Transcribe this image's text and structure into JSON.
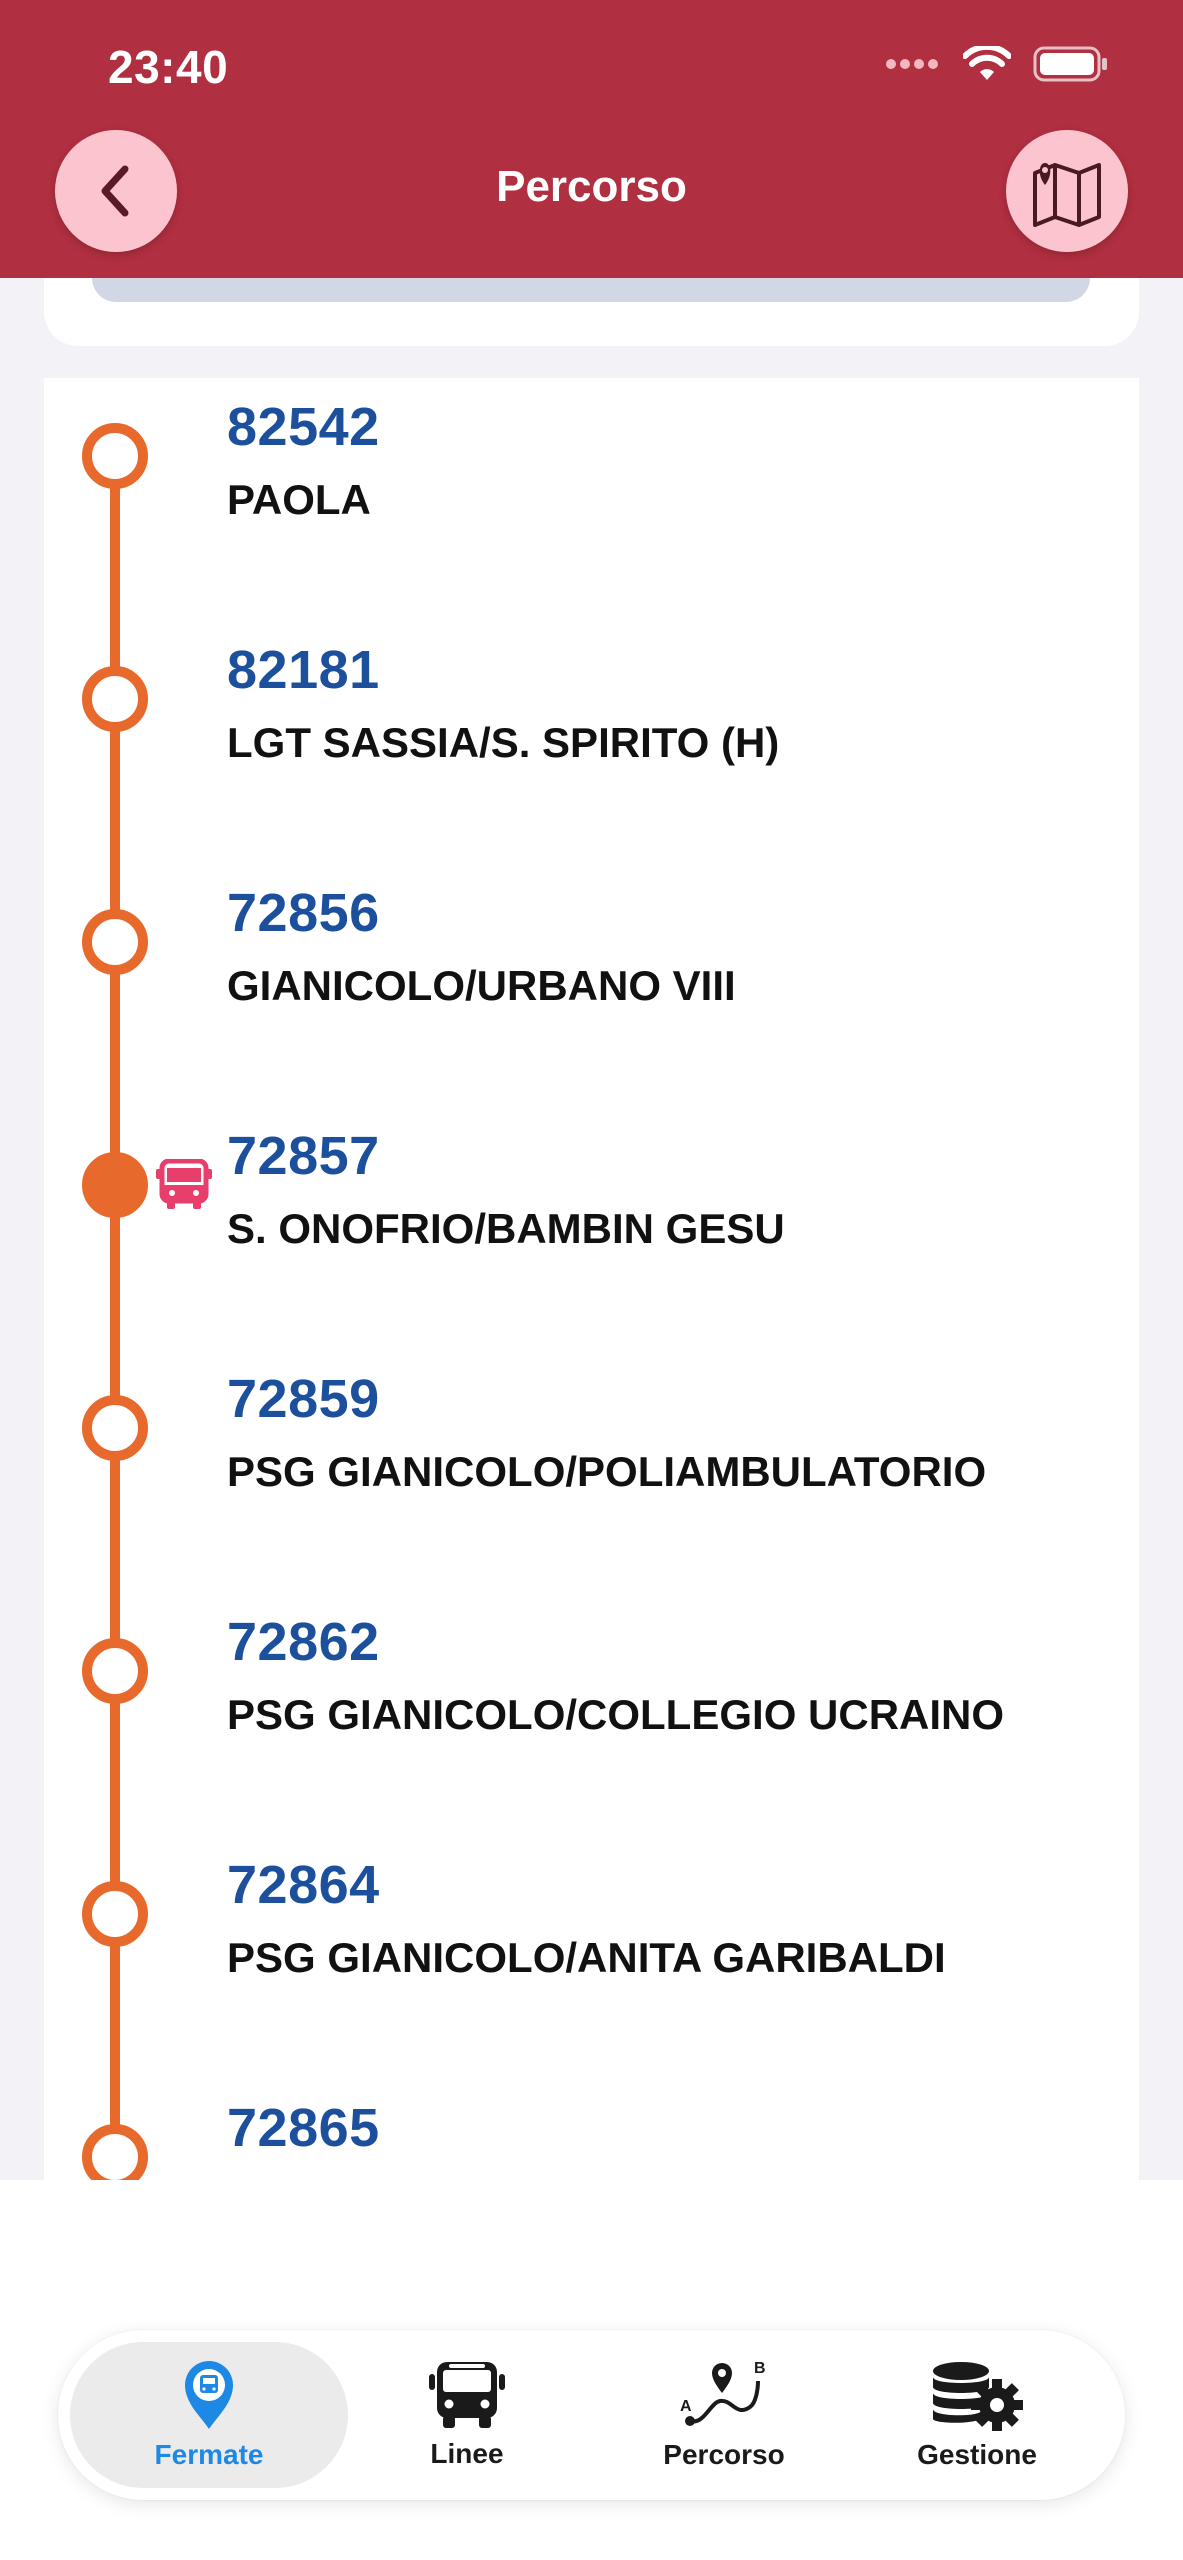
{
  "status_bar": {
    "time": "23:40"
  },
  "header": {
    "title": "Percorso"
  },
  "colors": {
    "header_bg": "#b02f40",
    "button_bg": "#fbc4cf",
    "route_line": "#e8692c",
    "stop_code": "#1c4f9c",
    "bus_icon": "#e83e6c",
    "active_tab": "#1e88e5"
  },
  "stops": [
    {
      "code": "82542",
      "name": "PAOLA",
      "current": false
    },
    {
      "code": "82181",
      "name": "LGT SASSIA/S. SPIRITO (H)",
      "current": false
    },
    {
      "code": "72856",
      "name": "GIANICOLO/URBANO VIII",
      "current": false
    },
    {
      "code": "72857",
      "name": "S. ONOFRIO/BAMBIN GESU",
      "current": true
    },
    {
      "code": "72859",
      "name": "PSG GIANICOLO/POLIAMBULATORIO",
      "current": false
    },
    {
      "code": "72862",
      "name": "PSG GIANICOLO/COLLEGIO UCRAINO",
      "current": false
    },
    {
      "code": "72864",
      "name": "PSG GIANICOLO/ANITA GARIBALDI",
      "current": false
    },
    {
      "code": "72865",
      "name": "",
      "current": false
    }
  ],
  "tabs": [
    {
      "label": "Fermate",
      "icon": "bus-stop-pin-icon",
      "active": true
    },
    {
      "label": "Linee",
      "icon": "bus-icon",
      "active": false
    },
    {
      "label": "Percorso",
      "icon": "route-icon",
      "active": false
    },
    {
      "label": "Gestione",
      "icon": "database-gear-icon",
      "active": false
    }
  ]
}
